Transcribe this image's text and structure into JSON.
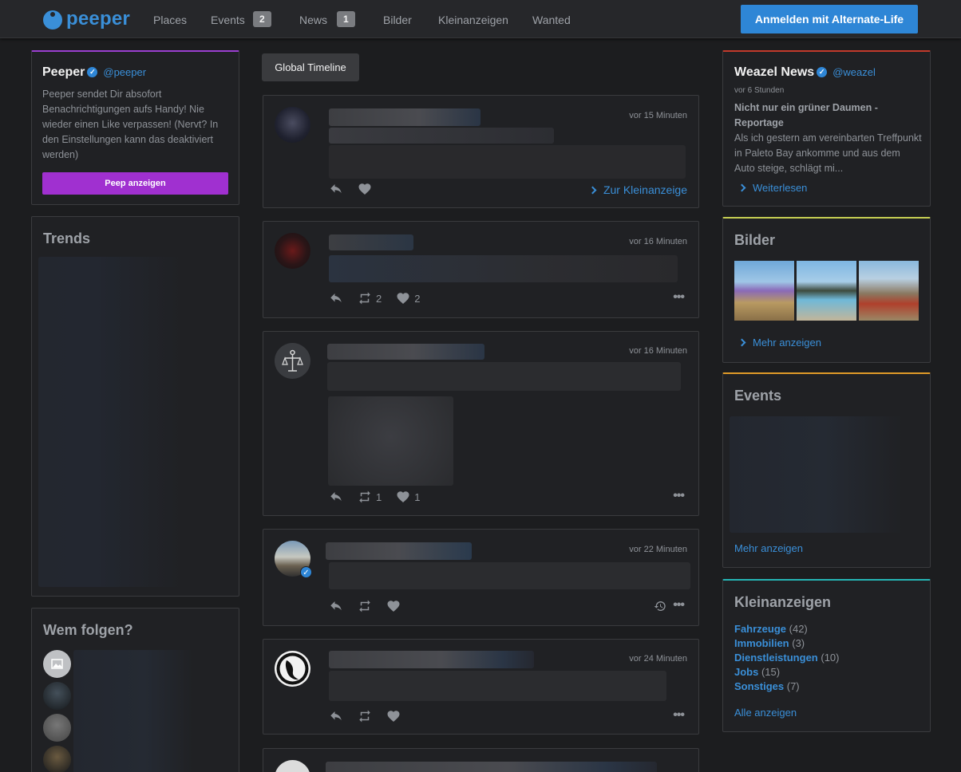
{
  "nav": {
    "logo": "peeper",
    "places": "Places",
    "events": "Events",
    "events_badge": "2",
    "news": "News",
    "news_badge": "1",
    "bilder": "Bilder",
    "kleinanzeigen": "Kleinanzeigen",
    "wanted": "Wanted",
    "login": "Anmelden mit Alternate-Life"
  },
  "peeper_card": {
    "name": "Peeper",
    "handle": "@peeper",
    "description": "Peeper sendet Dir absofort Benachrichtigungen aufs Handy! Nie wieder einen Like verpassen! (Nervt? In den Einstellungen kann das deaktiviert werden)",
    "button": "Peep anzeigen"
  },
  "trends": {
    "title": "Trends"
  },
  "follow": {
    "title": "Wem folgen?"
  },
  "timeline": {
    "tab": "Global Timeline",
    "posts": [
      {
        "time": "vor 15 Minuten",
        "link": "Zur Kleinanzeige"
      },
      {
        "time": "vor 16 Minuten",
        "retweets": "2",
        "likes": "2"
      },
      {
        "time": "vor 16 Minuten",
        "retweets": "1",
        "likes": "1"
      },
      {
        "time": "vor 22 Minuten"
      },
      {
        "time": "vor 24 Minuten"
      }
    ]
  },
  "news": {
    "name": "Weazel News",
    "handle": "@weazel",
    "time": "vor 6 Stunden",
    "headline": "Nicht nur ein grüner Daumen - Reportage",
    "excerpt": "Als ich gestern am vereinbarten Treffpunkt in Paleto Bay ankomme und aus dem Auto steige, schlägt mi...",
    "more": "Weiterlesen"
  },
  "bilder": {
    "title": "Bilder",
    "more": "Mehr anzeigen"
  },
  "events": {
    "title": "Events",
    "more": "Mehr anzeigen"
  },
  "kleinanzeigen": {
    "title": "Kleinanzeigen",
    "categories": [
      {
        "name": "Fahrzeuge",
        "count": "(42)"
      },
      {
        "name": "Immobilien",
        "count": "(3)"
      },
      {
        "name": "Dienstleistungen",
        "count": "(10)"
      },
      {
        "name": "Jobs",
        "count": "(15)"
      },
      {
        "name": "Sonstiges",
        "count": "(7)"
      }
    ],
    "all": "Alle anzeigen"
  },
  "colors": {
    "accent": "#2e86d6",
    "purple": "#a030d0",
    "background": "#1c1d1f"
  }
}
